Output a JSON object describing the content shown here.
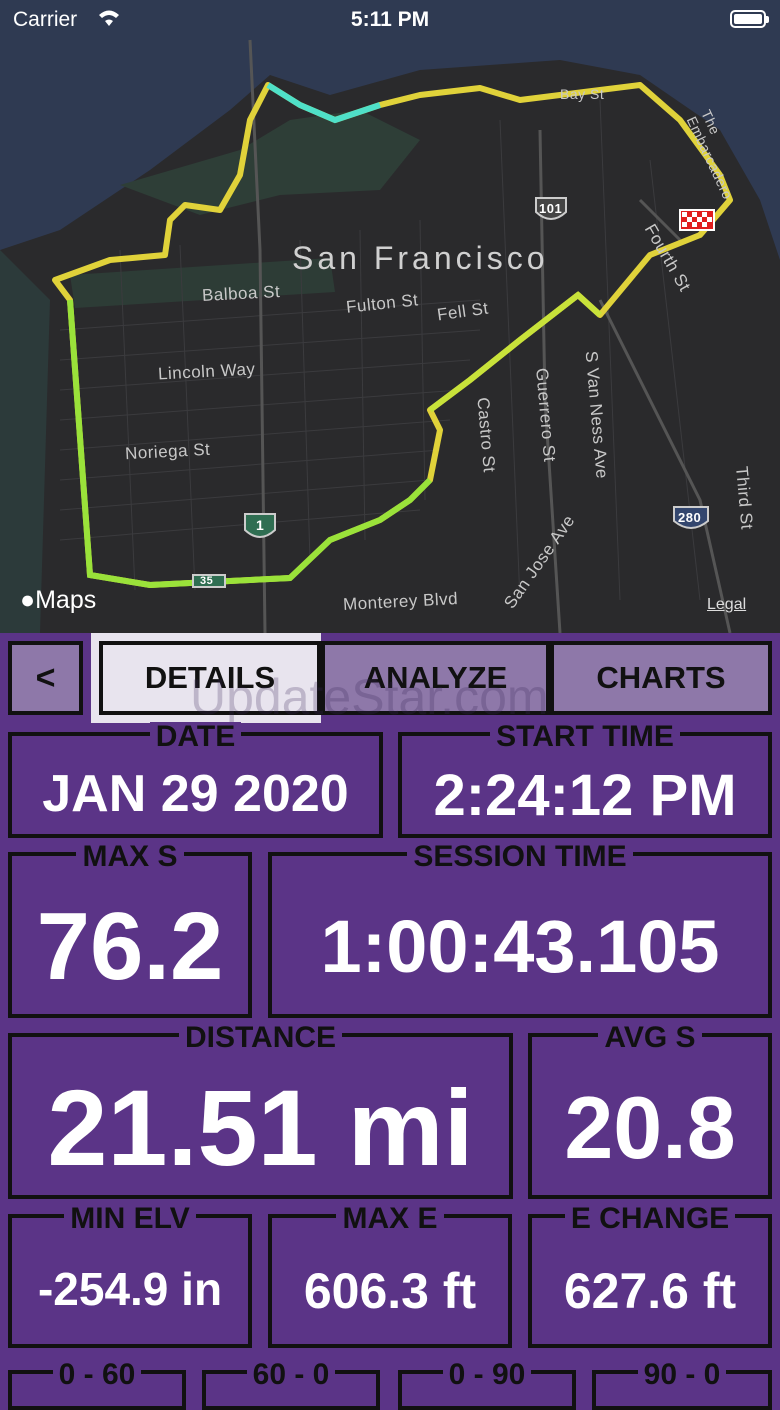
{
  "status_bar": {
    "carrier": "Carrier",
    "time": "5:11 PM"
  },
  "map": {
    "city": "San Francisco",
    "streets": [
      "Balboa St",
      "Fulton St",
      "Fell St",
      "Lincoln Way",
      "Noriega St",
      "Castro St",
      "Guerrero St",
      "S Van Ness Ave",
      "Fourth St",
      "Third St",
      "San Jose Ave",
      "Monterey Blvd",
      "Bay St",
      "The Embarcadero"
    ],
    "shields": [
      "101",
      "1",
      "280",
      "35"
    ],
    "attribution": "Maps",
    "legal": "Legal"
  },
  "tabs": {
    "back": "<",
    "details": "DETAILS",
    "analyze": "ANALYZE",
    "charts": "CHARTS",
    "watermark": "UpdateStar.com"
  },
  "stats": {
    "date": {
      "label": "DATE",
      "value": "JAN 29 2020"
    },
    "start_time": {
      "label": "START TIME",
      "value": "2:24:12 PM"
    },
    "max_speed": {
      "label": "MAX S",
      "value": "76.2"
    },
    "session_time": {
      "label": "SESSION TIME",
      "value": "1:00:43.105"
    },
    "distance": {
      "label": "DISTANCE",
      "value": "21.51 mi"
    },
    "avg_speed": {
      "label": "AVG S",
      "value": "20.8"
    },
    "min_elevation": {
      "label": "MIN ELV",
      "value": "-254.9 in"
    },
    "max_elevation": {
      "label": "MAX E",
      "value": "606.3 ft"
    },
    "elevation_change": {
      "label": "E CHANGE",
      "value": "627.6 ft"
    },
    "row5": [
      {
        "label": "0 - 60"
      },
      {
        "label": "60 - 0"
      },
      {
        "label": "0 - 90"
      },
      {
        "label": "90 - 0"
      }
    ]
  },
  "colors": {
    "accent": "#5b3487",
    "tab_bg": "#8e78a9",
    "active_tab": "#e8e4ee"
  }
}
